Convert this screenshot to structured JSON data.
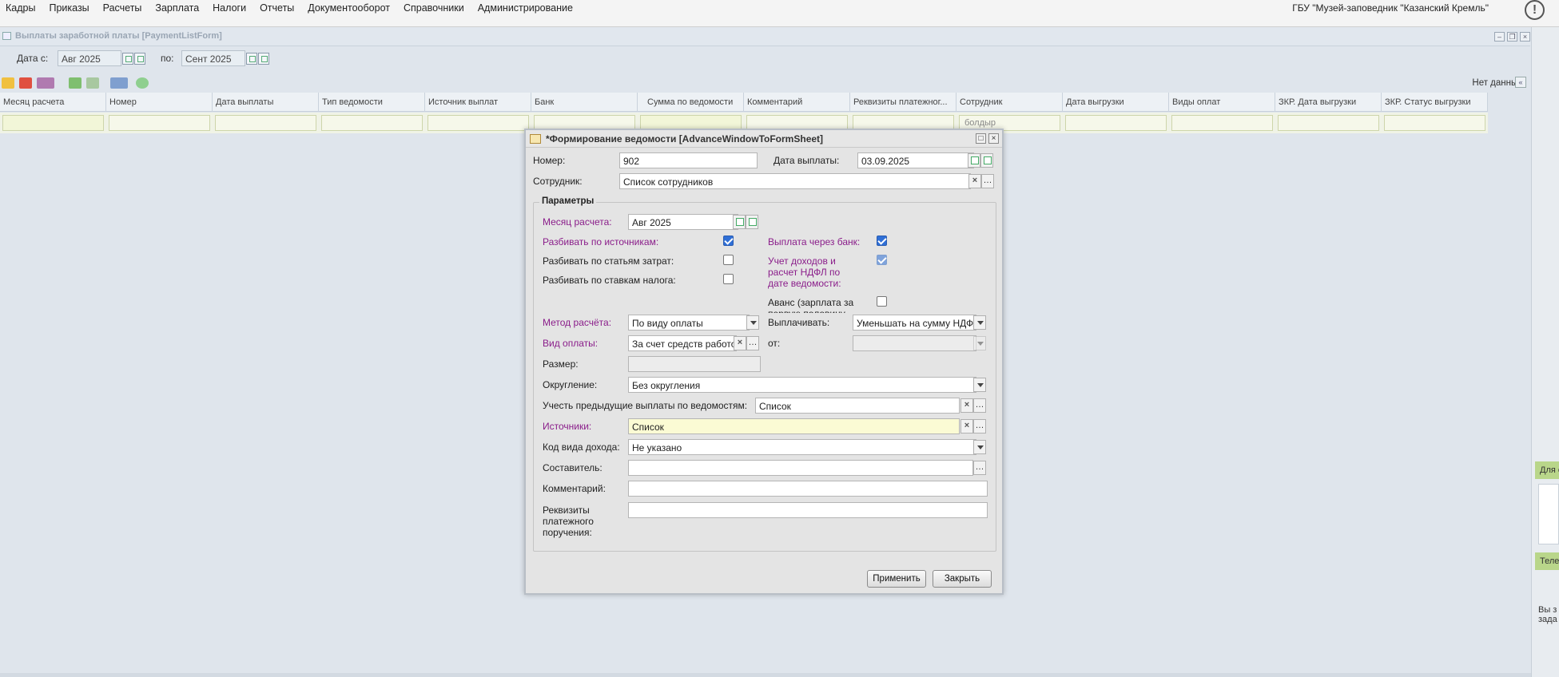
{
  "menu": [
    "Кадры",
    "Приказы",
    "Расчеты",
    "Зарплата",
    "Налоги",
    "Отчеты",
    "Документооборот",
    "Справочники",
    "Администрирование"
  ],
  "org_name": "ГБУ \"Музей-заповедник \"Казанский Кремль\"",
  "panel": {
    "title": "Выплаты заработной платы [PaymentListForm]",
    "date_from_label": "Дата с:",
    "date_from": "Авг 2025",
    "date_to_label": "по:",
    "date_to": "Сент 2025",
    "no_data": "Нет данных"
  },
  "grid": {
    "columns": [
      "Месяц расчета",
      "Номер",
      "Дата выплаты",
      "Тип ведомости",
      "Источник выплат",
      "Банк",
      "Сумма по ведомости",
      "Комментарий",
      "Реквизиты платежног...",
      "Сотрудник",
      "Дата выгрузки",
      "Виды оплат",
      "ЗКР. Дата выгрузки",
      "ЗКР. Статус выгрузки"
    ],
    "employee_filter": "болдыр"
  },
  "right_side": {
    "tab1": "Для с",
    "tab2": "Теле",
    "text": "Вы з задa"
  },
  "modal": {
    "title": "*Формирование ведомости [AdvanceWindowToFormSheet]",
    "number_label": "Номер:",
    "number": "902",
    "pay_date_label": "Дата выплаты:",
    "pay_date": "03.09.2025",
    "employee_label": "Сотрудник:",
    "employee": "Список сотрудников",
    "params_legend": "Параметры",
    "calc_month_label": "Месяц расчета:",
    "calc_month": "Авг 2025",
    "split_sources_label": "Разбивать по источникам:",
    "split_sources": true,
    "split_costs_label": "Разбивать по статьям затрат:",
    "split_costs": false,
    "split_tax_label": "Разбивать по ставкам налога:",
    "split_tax": false,
    "bank_pay_label": "Выплата через банк:",
    "bank_pay": true,
    "ndfl_label": "Учет доходов и расчет НДФЛ по дате ведомости:",
    "ndfl": true,
    "advance_label": "Аванс (зарплата за первую половину",
    "advance": false,
    "method_label": "Метод расчёта:",
    "method": "По виду оплаты",
    "payout_label": "Выплачивать:",
    "payout": "Уменьшать на сумму НДФЛ",
    "paytype_label": "Вид оплаты:",
    "paytype": "За счет средств работодателя",
    "from_label": "от:",
    "from": "",
    "size_label": "Размер:",
    "size": "",
    "rounding_label": "Округление:",
    "rounding": "Без округления",
    "prev_payments_label": "Учесть предыдущие выплаты по ведомостям:",
    "prev_payments": "Список",
    "sources_label": "Источники:",
    "sources": "Список",
    "income_code_label": "Код вида дохода:",
    "income_code": "Не указано",
    "author_label": "Составитель:",
    "author": "",
    "comment_label": "Комментарий:",
    "comment": "",
    "requisites_label": "Реквизиты платежного поручения:",
    "requisites": "",
    "apply": "Применить",
    "close": "Закрыть"
  }
}
